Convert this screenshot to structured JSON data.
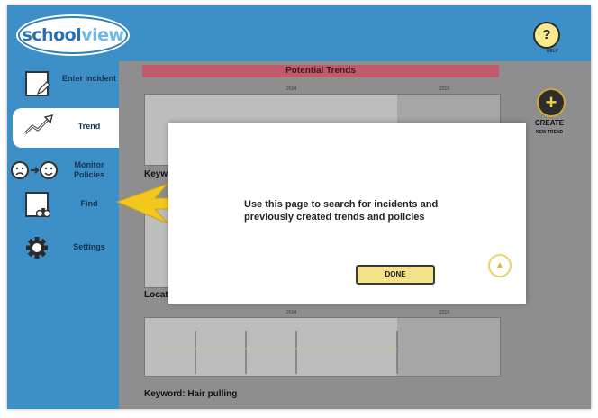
{
  "app": {
    "logo_part1": "school",
    "logo_part2": "view",
    "help_label": "HELP"
  },
  "sidebar": {
    "items": [
      {
        "label": "Enter Incident",
        "icon": "pencil-paper-icon"
      },
      {
        "label": "Trend",
        "icon": "trend-chart-icon"
      },
      {
        "label": "Monitor Policies",
        "icon": "sad-to-happy-icon"
      },
      {
        "label": "Find",
        "icon": "binoculars-icon"
      },
      {
        "label": "Settings",
        "icon": "gear-icon"
      }
    ]
  },
  "main": {
    "header": "Potential Trends",
    "create_label": "CREATE",
    "create_sub": "NEW TREND",
    "charts": [
      {
        "year_left": "2014",
        "year_right": "2015",
        "keyword": "Keyw"
      },
      {
        "keyword": "Locat"
      },
      {
        "year_left": "2014",
        "year_right": "2015",
        "keyword": "Keyword: Hair pulling"
      }
    ]
  },
  "modal": {
    "message": "Use this page to search for incidents and previously created trends and policies",
    "done_label": "DONE"
  },
  "colors": {
    "sidebar_blue": "#3d8fc7",
    "header_pink": "#c25a6e",
    "button_yellow": "#f3e289",
    "arrow_yellow": "#f2c81e"
  }
}
